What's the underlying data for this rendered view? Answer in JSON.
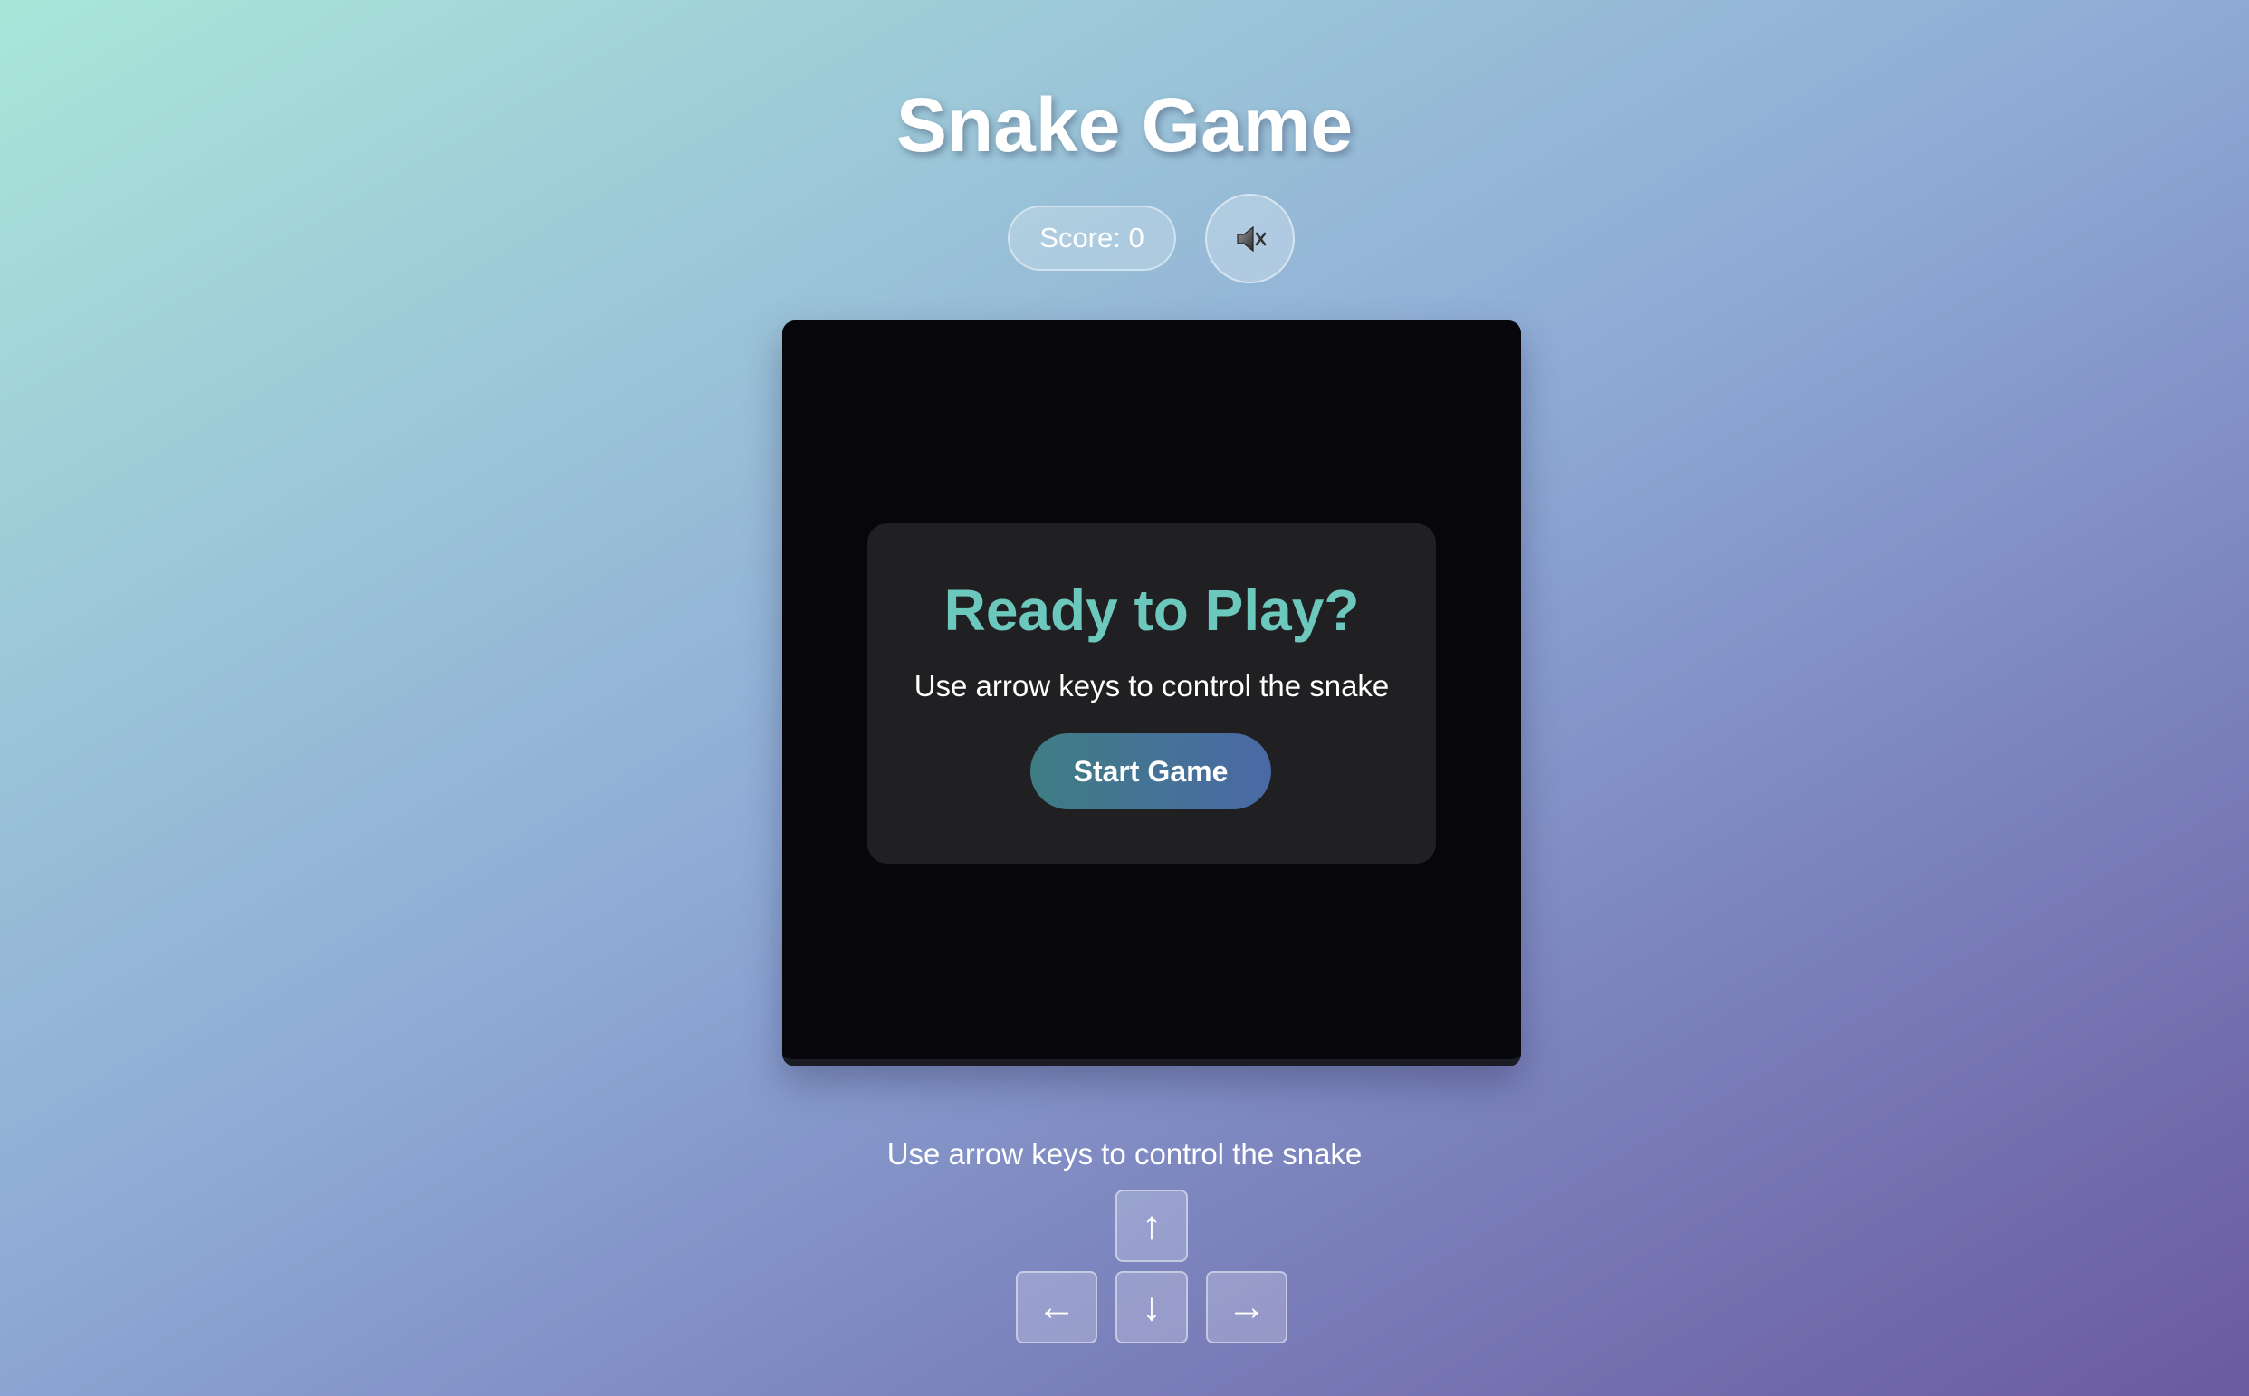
{
  "header": {
    "title": "Snake Game"
  },
  "status": {
    "score_label": "Score: 0",
    "sound_icon": "speaker-muted-icon"
  },
  "board": {
    "overlay": {
      "title": "Ready to Play?",
      "subtitle": "Use arrow keys to control the snake",
      "start_label": "Start Game"
    }
  },
  "controls": {
    "instructions": "Use arrow keys to control the snake",
    "up": "↑",
    "left": "←",
    "down": "↓",
    "right": "→"
  },
  "colors": {
    "accent": "#6cc7bc",
    "board_bg": "#06060b",
    "overlay_bg": "#202023",
    "button_gradient_start": "#3f7d84",
    "button_gradient_end": "#4a69a6"
  }
}
